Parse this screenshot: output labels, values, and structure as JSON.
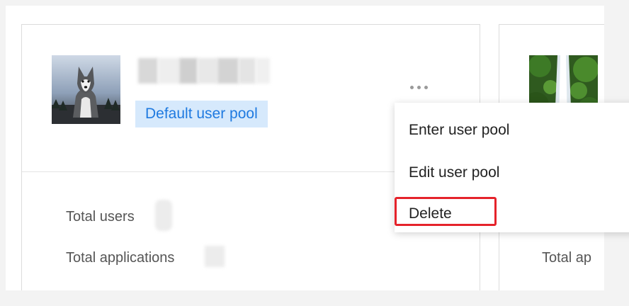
{
  "card": {
    "badge": "Default user pool",
    "stats": {
      "total_users_label": "Total users",
      "total_applications_label": "Total applications"
    }
  },
  "card2": {
    "total_applications_partial": "Total ap"
  },
  "menu": {
    "items": [
      "Enter user pool",
      "Edit user pool",
      "Delete"
    ]
  },
  "colors": {
    "badge_bg": "#d6e9fc",
    "badge_text": "#1f7ae0",
    "highlight": "#e5232b"
  }
}
